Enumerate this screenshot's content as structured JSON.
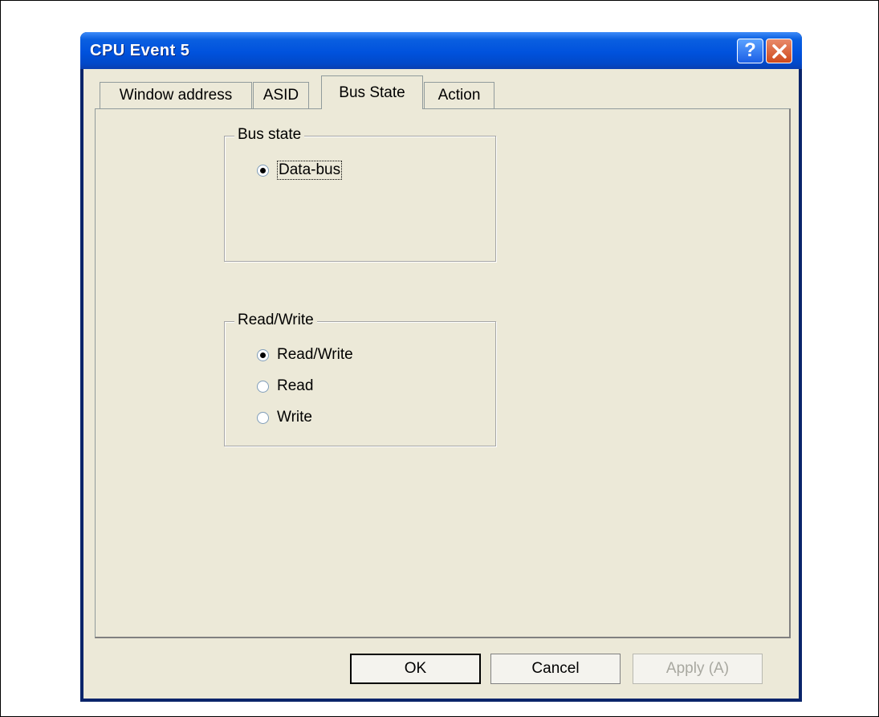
{
  "window": {
    "title": "CPU Event 5",
    "help_glyph": "?"
  },
  "tabs": [
    "Window address",
    "ASID",
    "Bus State",
    "Action"
  ],
  "bus_state_group": {
    "title": "Bus state",
    "options": [
      {
        "label": "Data-bus",
        "selected": true
      }
    ]
  },
  "rw_group": {
    "title": "Read/Write",
    "options": [
      {
        "label": "Read/Write",
        "selected": true
      },
      {
        "label": "Read",
        "selected": false
      },
      {
        "label": "Write",
        "selected": false
      }
    ]
  },
  "buttons": {
    "ok": "OK",
    "cancel": "Cancel",
    "apply": "Apply (A)"
  },
  "colors": {
    "titlebar": "#0052dd",
    "dialog_bg": "#ece9d8"
  }
}
